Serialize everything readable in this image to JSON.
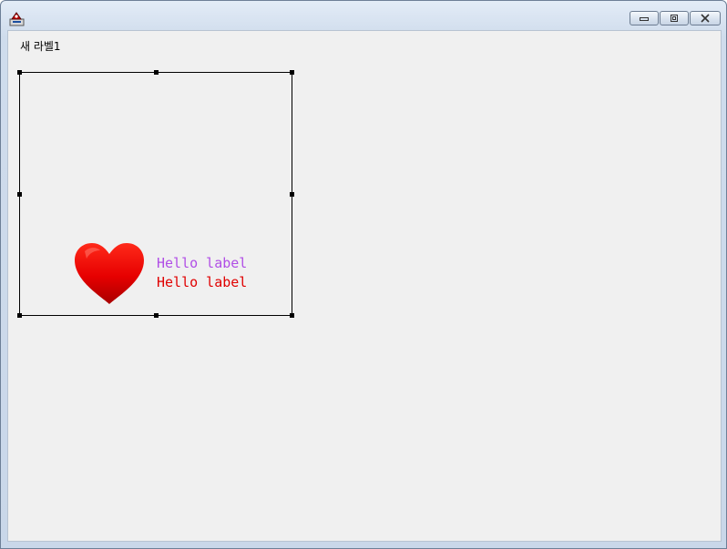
{
  "window": {
    "app_icon": "java-duke-icon",
    "controls": {
      "minimize_icon": "minimize-icon",
      "maximize_icon": "maximize-icon",
      "close_icon": "close-icon"
    }
  },
  "content": {
    "top_label": "새 라벨1",
    "selected_component": {
      "icon": "heart-icon",
      "lines": [
        {
          "text": "Hello label",
          "color": "#b04ee6"
        },
        {
          "text": "Hello label",
          "color": "#e00000"
        }
      ]
    }
  }
}
